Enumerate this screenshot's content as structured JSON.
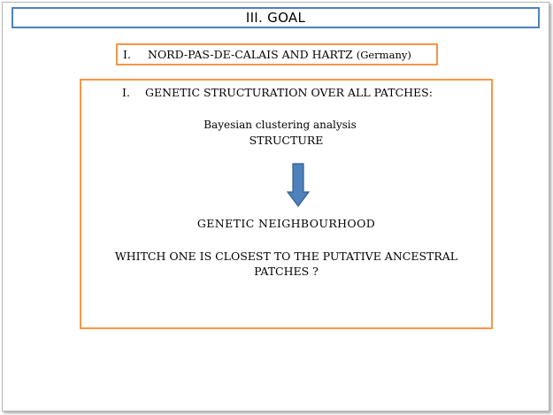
{
  "slide": {
    "title": "III. GOAL",
    "subtitle": {
      "number": "I.",
      "text": "NORD-PAS-DE-CALAIS AND HARTZ",
      "paren": "(Germany)"
    },
    "content": {
      "heading_number": "I.",
      "heading_text": "GENETIC STRUCTURATION OVER ALL PATCHES:",
      "method_line1": "Bayesian clustering  analysis",
      "method_line2": "STRUCTURE",
      "arrow_icon": "down-arrow-icon",
      "result": "GENETIC NEIGHBOURHOOD",
      "question_line1": "WHITCH ONE IS CLOSEST TO THE PUTATIVE ANCESTRAL",
      "question_line2": "PATCHES ?"
    }
  },
  "colors": {
    "title_border": "#4f81bd",
    "box_border": "#f79646",
    "arrow_fill": "#4f81bd",
    "arrow_stroke": "#385d8a"
  }
}
